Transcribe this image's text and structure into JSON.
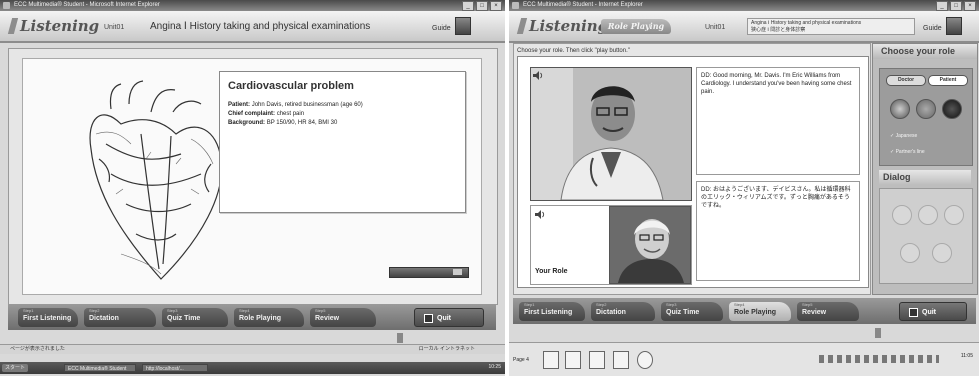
{
  "left": {
    "window_title": "ECC Multimedia® Student - Microsoft Internet Explorer",
    "app_logo": "Listening",
    "unit": "Unit01",
    "lesson_title": "Angina Ⅰ History taking and physical examinations",
    "guide": "Guide",
    "info": {
      "title": "Cardiovascular problem",
      "patient_label": "Patient:",
      "patient_value": "John Davis, retired businessman (age 60)",
      "complaint_label": "Chief complaint:",
      "complaint_value": "chest pain",
      "background_label": "Background:",
      "background_value": "BP 150/90, HR 84, BMI 30"
    },
    "nav": [
      {
        "num": "Step1",
        "label": "First Listening"
      },
      {
        "num": "Step2",
        "label": "Dictation"
      },
      {
        "num": "Step3",
        "label": "Quiz Time"
      },
      {
        "num": "Step4",
        "label": "Role Playing"
      },
      {
        "num": "Step5",
        "label": "Review"
      }
    ],
    "quit": "Quit",
    "status_left": "ページが表示されました",
    "status_right": "ローカル イントラネット",
    "taskbar": {
      "start": "スタート",
      "items": [
        "ECC Multimedia® Student",
        "http://localhost/..."
      ],
      "clock": "10:25"
    }
  },
  "right": {
    "window_title": "ECC Multimedia® Student - Internet Explorer",
    "app_logo": "Listening",
    "mode": "Role Playing",
    "unit": "Unit01",
    "lesson_title": "Angina Ⅰ History taking and physical examinations",
    "lesson_subtitle": "狭心症 Ⅰ 問診と身体診察",
    "guide": "Guide",
    "instruction": "Choose your role. Then click \"play button.\"",
    "dialog_en": "DD: Good morning, Mr. Davis. I'm Eric Williams from Cardiology. I understand you've been having some chest pain.",
    "dialog_ja": "DD: おはようございます、デイビスさん。私は循環器科のエリック・ウィリアムズです。ずっと胸痛があるそうですね。",
    "your_role": "Your Role",
    "side": {
      "title": "Choose your role",
      "role_doctor": "Doctor",
      "role_patient": "Patient",
      "check1": "Japanese",
      "check2": "Partner's line",
      "dialog_title": "Dialog"
    },
    "nav": [
      {
        "num": "Step1",
        "label": "First Listening"
      },
      {
        "num": "Step2",
        "label": "Dictation"
      },
      {
        "num": "Step3",
        "label": "Quiz Time"
      },
      {
        "num": "Step4",
        "label": "Role Playing"
      },
      {
        "num": "Step5",
        "label": "Review"
      }
    ],
    "quit": "Quit",
    "pager": "Page 4",
    "clock": "11:05"
  }
}
